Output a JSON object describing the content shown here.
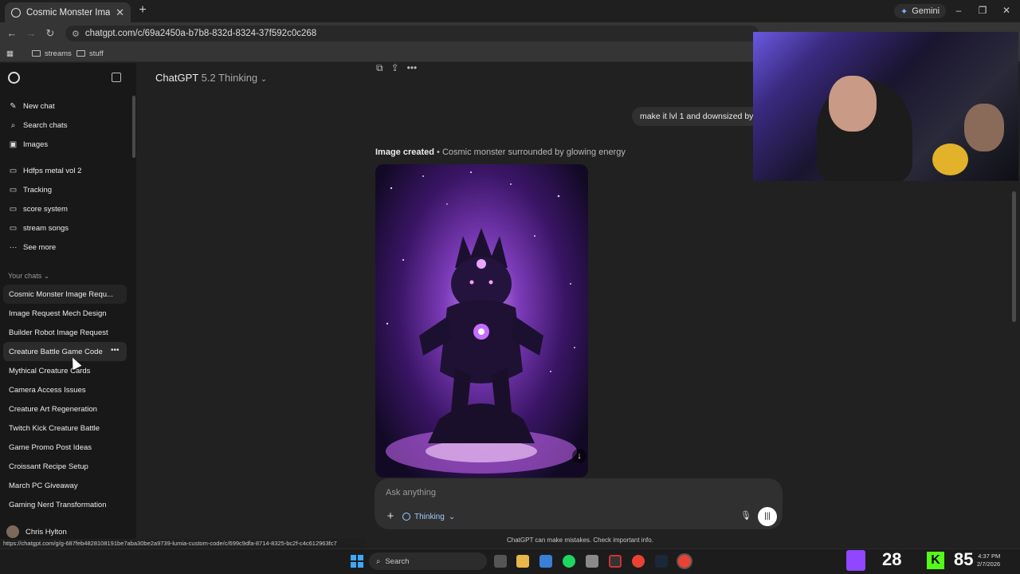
{
  "browser": {
    "tab_title": "Cosmic Monster Image Request",
    "url": "chatgpt.com/c/69a2450a-b7b8-832d-8324-37f592c0c268",
    "gemini_label": "Gemini",
    "bookmarks": [
      "streams",
      "stuff"
    ]
  },
  "sidebar": {
    "top_items": [
      {
        "label": "New chat",
        "icon": "pencil-icon"
      },
      {
        "label": "Search chats",
        "icon": "search-icon"
      },
      {
        "label": "Images",
        "icon": "image-icon"
      }
    ],
    "projects": [
      {
        "label": "Hdfps metal vol 2",
        "icon": "folder-icon"
      },
      {
        "label": "Tracking",
        "icon": "folder-icon"
      },
      {
        "label": "score system",
        "icon": "folder-icon"
      },
      {
        "label": "stream songs",
        "icon": "folder-icon"
      },
      {
        "label": "See more",
        "icon": "more-icon"
      }
    ],
    "section_label": "Your chats",
    "chats": [
      "Cosmic Monster Image Requ...",
      "Image Request Mech Design",
      "Builder Robot Image Request",
      "Creature Battle Game Code",
      "Mythical Creature Cards",
      "Camera Access Issues",
      "Creature Art Regeneration",
      "Twitch Kick Creature Battle",
      "Game Promo Post Ideas",
      "Croissant Recipe Setup",
      "March PC Giveaway",
      "Gaming Nerd Transformation"
    ],
    "user_name": "Chris Hylton"
  },
  "main": {
    "model_name": "ChatGPT",
    "model_version": "5.2 Thinking",
    "user_message": "make it lvl 1 and downsized by",
    "image_caption_strong": "Image created",
    "image_caption_rest": " • Cosmic monster surrounded by glowing energy",
    "composer_placeholder": "Ask anything",
    "thinking_label": "Thinking",
    "disclaimer": "ChatGPT can make mistakes. Check important info."
  },
  "status_link": "https://chatgpt.com/g/g-687feb4828108191be7aba30be2a9739-lumia-custom-code/c/699c9dfa-8714-8325-bc2f-c4c612963fc7",
  "taskbar": {
    "search_label": "Search",
    "twitch_count": "28",
    "kick_label": "K",
    "kick_count": "85",
    "time": "4:37 PM",
    "date": "2/7/2026"
  },
  "colors": {
    "accent_blue": "#9ecbff",
    "twitch": "#9146ff",
    "kick": "#53fc18"
  }
}
